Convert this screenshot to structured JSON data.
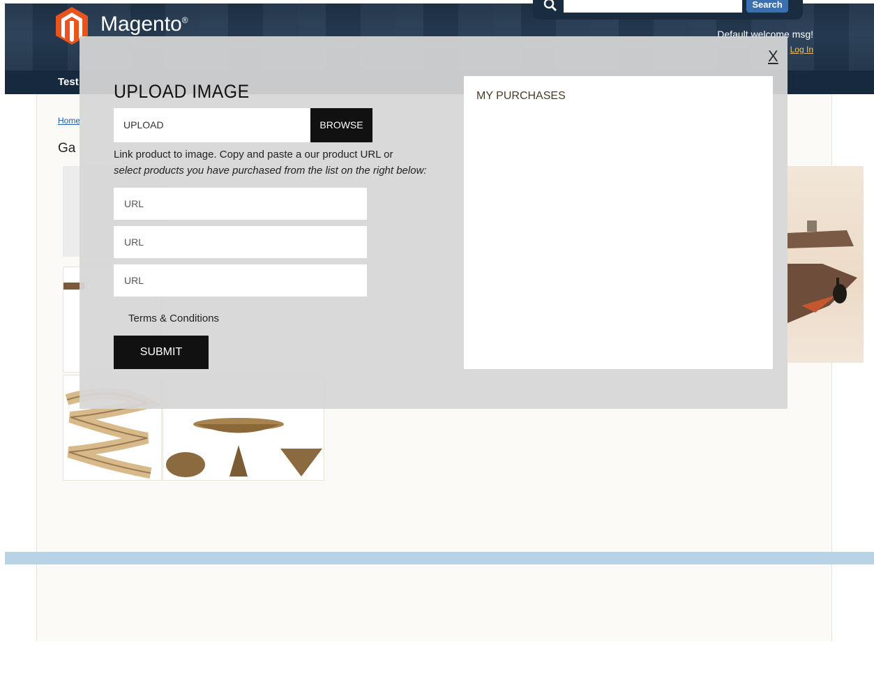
{
  "store": {
    "brand": "Magento",
    "brand_mark": "®",
    "search_button": "Search",
    "welcome": "Default welcome msg!",
    "login_link": "Log In",
    "nav_item": "Test",
    "breadcrumb": "Home",
    "gallery_heading": "Ga"
  },
  "modal": {
    "close": "X",
    "title": "UPLOAD IMAGE",
    "upload_placeholder": "UPLOAD",
    "browse_label": "BROWSE",
    "help_line1": "Link product to image. Copy and paste a our product URL or",
    "help_line2": "select products you have purchased from the list on the right below:",
    "url_fields": [
      "URL",
      "URL",
      "URL"
    ],
    "terms_label": "Terms & Conditions",
    "submit_label": "SUBMIT",
    "purchases_title": "MY PURCHASES"
  },
  "colors": {
    "header": "#1e3247",
    "accent_button": "#111111",
    "footer_band": "#b9d3e6"
  }
}
